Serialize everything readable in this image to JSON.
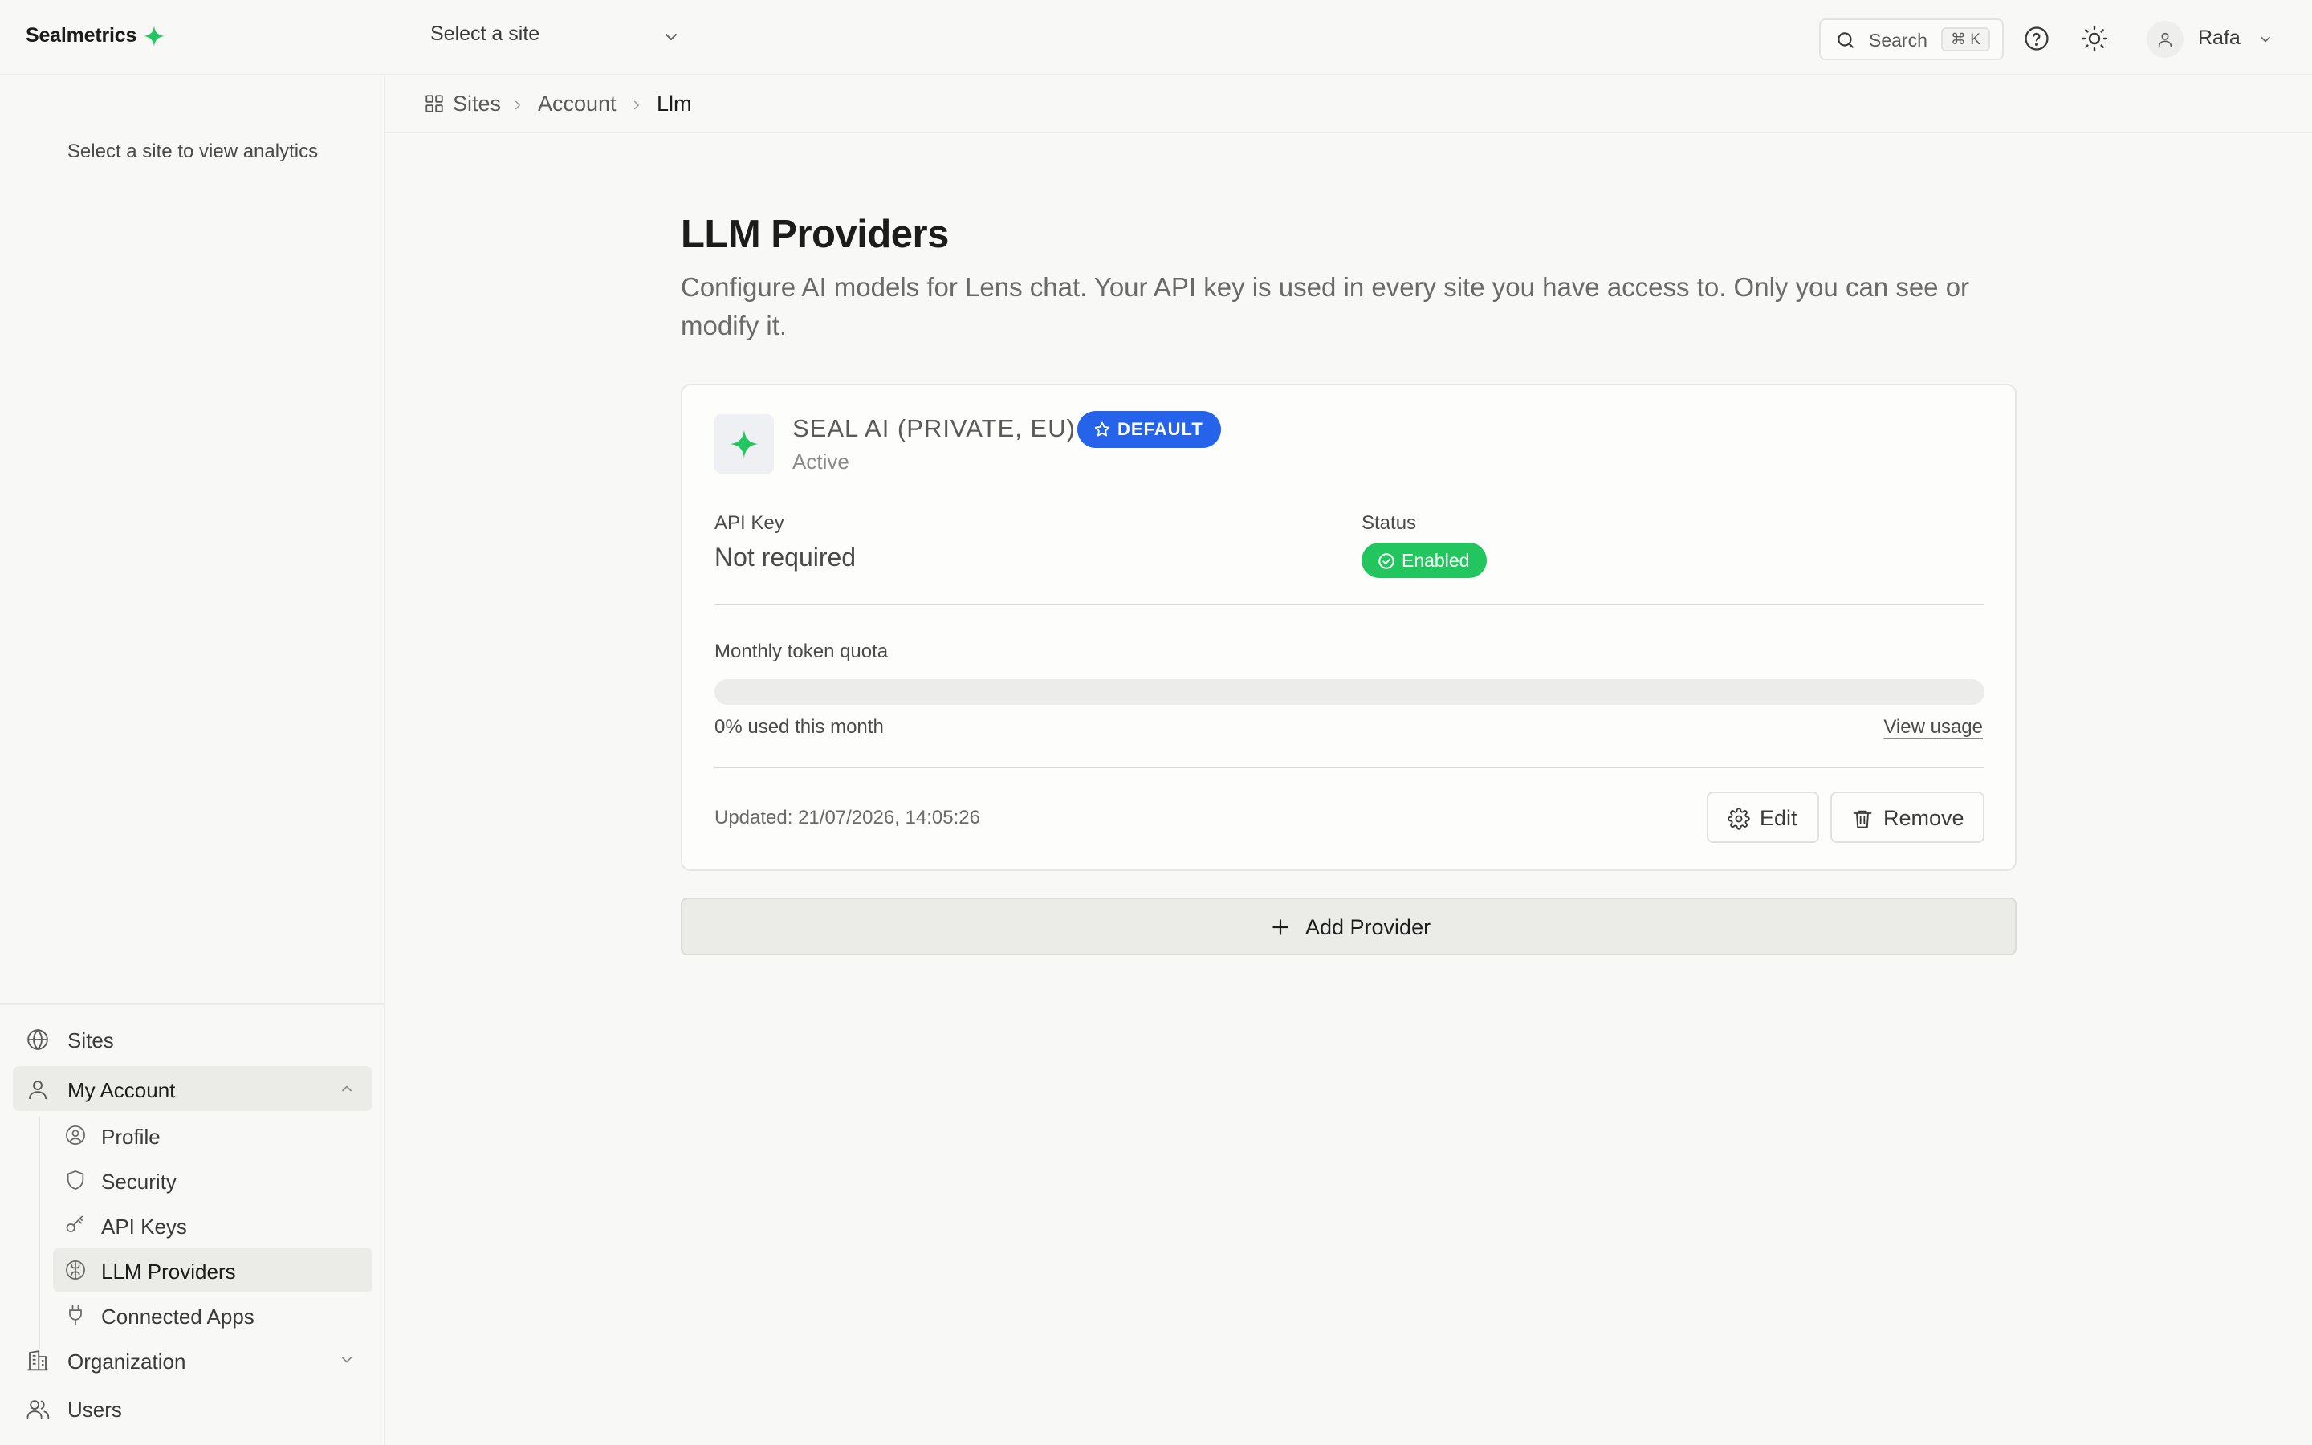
{
  "app": {
    "brand": "Sealmetrics",
    "accent": "#22c55e"
  },
  "topbar": {
    "site_select_placeholder": "Select a site",
    "search_label": "Search",
    "search_shortcut": "⌘ K",
    "user_name": "Rafa"
  },
  "sidebar": {
    "empty_message": "Select a site to view analytics",
    "items": [
      {
        "label": "Sites",
        "icon": "globe-icon"
      },
      {
        "label": "My Account",
        "icon": "user-icon",
        "expanded": true
      },
      {
        "label": "Profile",
        "icon": "user-circle-icon"
      },
      {
        "label": "Security",
        "icon": "shield-icon"
      },
      {
        "label": "API Keys",
        "icon": "key-icon"
      },
      {
        "label": "LLM Providers",
        "icon": "brain-icon",
        "active": true
      },
      {
        "label": "Connected Apps",
        "icon": "plug-icon"
      },
      {
        "label": "Organization",
        "icon": "building-icon"
      },
      {
        "label": "Users",
        "icon": "users-icon"
      }
    ]
  },
  "breadcrumb": [
    "Sites",
    "Account",
    "Llm"
  ],
  "page": {
    "title": "LLM Providers",
    "description": "Configure AI models for Lens chat. Your API key is used in every site you have access to. Only you can see or modify it."
  },
  "provider": {
    "name": "SEAL AI (PRIVATE, EU)",
    "default_badge": "DEFAULT",
    "state": "Active",
    "api_key_label": "API Key",
    "api_key_value": "Not required",
    "status_label": "Status",
    "status_value": "Enabled",
    "quota_label": "Monthly token quota",
    "quota_used_fraction": 0,
    "quota_used_text": "0% used this month",
    "view_usage": "View usage",
    "updated": "Updated: 21/07/2026, 14:05:26",
    "edit_label": "Edit",
    "remove_label": "Remove",
    "default_color": "#2563eb",
    "enabled_color": "#22c55e"
  },
  "add_provider_label": "Add Provider"
}
